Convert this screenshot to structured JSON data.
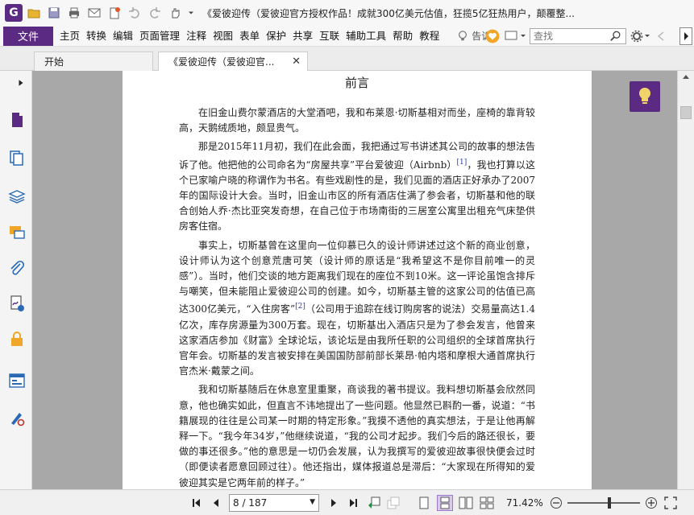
{
  "window": {
    "logo": "G",
    "title": "《爱彼迎传（爱彼迎官方授权作品！成就300亿美元估值，狂揽5亿狂热用户，颠覆整..."
  },
  "menu": {
    "file": "文件",
    "items": [
      "主页",
      "转换",
      "编辑",
      "页面管理",
      "注释",
      "视图",
      "表单",
      "保护",
      "共享",
      "互联",
      "辅助工具",
      "帮助",
      "教程"
    ],
    "tell_me": "告诉",
    "search_placeholder": "查找"
  },
  "tabs": [
    {
      "label": "开始"
    },
    {
      "label": "《爱彼迎传（爱彼迎官...",
      "close": "✕"
    }
  ],
  "page": {
    "heading": "前言",
    "paragraphs": [
      {
        "text": "在旧金山费尔蒙酒店的大堂酒吧，我和布莱恩·切斯基相对而坐，座椅的靠背较高，天鹅绒质地，颇显贵气。"
      },
      {
        "text": "那是2015年11月初，我们在此会面，我把通过写书讲述其公司的故事的想法告诉了他。他把他的公司命名为“房屋共享”平台爱彼迎（Airbnb）",
        "fn": "[1]",
        "rest": "，我也打算以这个已家喻户晓的称谓作为书名。有些戏剧性的是，我们见面的酒店正好承办了2007年的国际设计大会。当时，旧金山市区的所有酒店住满了参会者，切斯基和他的联合创始人乔·杰比亚突发奇想，在自己位于市场南街的三居室公寓里出租充气床垫供房客住宿。"
      },
      {
        "text": "事实上，切斯基曾在这里向一位仰慕已久的设计师讲述过这个新的商业创意，设计师认为这个创意荒唐可笑（设计师的原话是“我希望这不是你目前唯一的灵感”）。当时，他们交谈的地方距离我们现在的座位不到10米。这一评论虽饱含排斥与嘲笑，但未能阻止爱彼迎公司的创建。如今，切斯基主管的这家公司的估值已高达300亿美元，“入住房客”",
        "fn": "[2]",
        "rest": "（公司用于追踪在线订购房客的说法）交易量高达1.4亿次，库存房源量为300万套。现在，切斯基出入酒店只是为了参会发言，他曾来这家酒店参加《财富》全球论坛，该论坛是由我所任职的公司组织的全球首席执行官年会。切斯基的发言被安排在美国国防部前部长莱昂·帕内塔和摩根大通首席执行官杰米·戴蒙之间。"
      },
      {
        "text": "我和切斯基随后在休息室里重聚，商谈我的著书提议。我料想切斯基会欣然同意，他也确实如此，但直言不讳地提出了一些问题。他显然已斟酌一番，说道：“书籍展现的往往是公司某一时期的特定形象。”我摸不透他的真实想法，于是让他再解释一下。“我今年34岁，”他继续说道，“我的公司才起步。我们今后的路还很长，要做的事还很多。”他的意思是一切仍会发展，认为我撰写的爱彼迎故事很快便会过时（即便读者愿意回顾过往）。他还指出，媒体报道总是滞后：“大家现在所得知的爱彼迎其实是它两年前的样子。”"
      }
    ]
  },
  "status": {
    "page_indicator": "8 / 187",
    "zoom": "71.42%"
  },
  "colors": {
    "brand": "#5b2a82",
    "doc_background": "#a8a8a8"
  }
}
